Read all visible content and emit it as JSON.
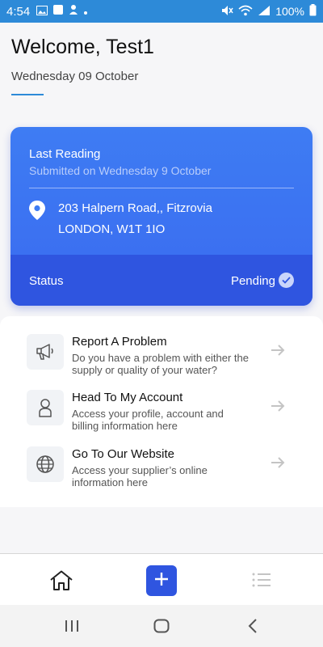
{
  "status_bar": {
    "time": "4:54",
    "battery": "100%",
    "icons": [
      "image-icon",
      "notification-icon",
      "dot-icon",
      "mute-icon",
      "wifi-icon",
      "signal-icon",
      "battery-icon"
    ]
  },
  "header": {
    "welcome": "Welcome, Test1",
    "date": "Wednesday 09 October",
    "accent_color": "#2d8ad8"
  },
  "reading_card": {
    "title": "Last Reading",
    "submitted": "Submitted on Wednesday 9 October",
    "address_line1": "203 Halpern Road,, Fitzrovia",
    "address_line2": "LONDON, W1T 1IO",
    "status_label": "Status",
    "status_value": "Pending",
    "card_color": "#3e7cf3",
    "status_band_color": "#2f55e0",
    "icons": [
      "location-pin-icon",
      "check-icon"
    ]
  },
  "actions": [
    {
      "title": "Report A Problem",
      "description": "Do you have a problem with either the supply or quality of your water?",
      "icon": "megaphone-icon"
    },
    {
      "title": "Head To My Account",
      "description": "Access your profile, account and billing information here",
      "icon": "user-icon"
    },
    {
      "title": "Go To Our Website",
      "description": "Access your supplier’s online information here",
      "icon": "globe-icon"
    }
  ],
  "bottom_nav": {
    "items": [
      "home-icon",
      "add-icon",
      "list-icon"
    ],
    "add_color": "#2f55e0"
  },
  "system_nav": {
    "items": [
      "recent-apps-icon",
      "home-circle-icon",
      "back-icon"
    ]
  }
}
